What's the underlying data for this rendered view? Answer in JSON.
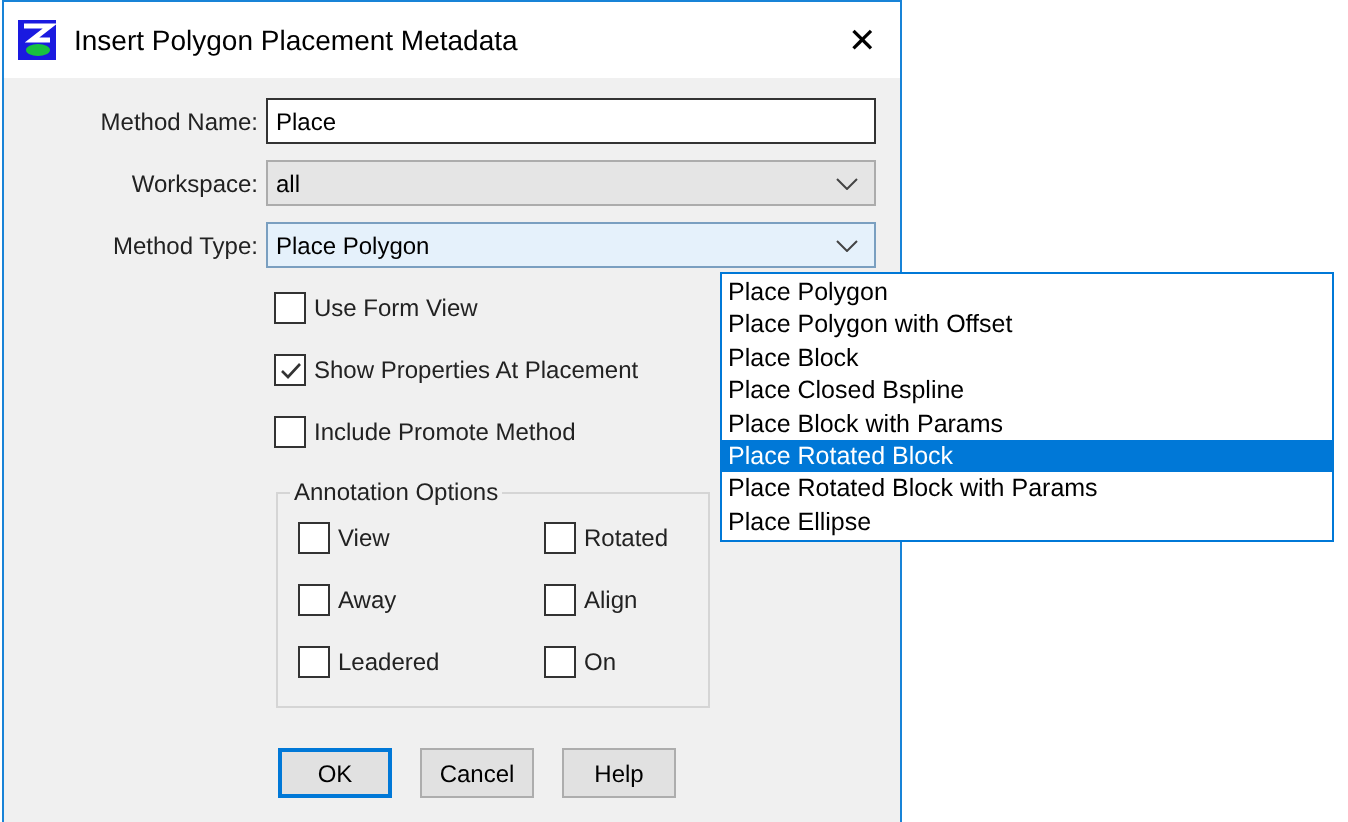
{
  "window": {
    "title": "Insert Polygon Placement Metadata",
    "close": "✕"
  },
  "fields": [
    {
      "kind": "text",
      "label": "Method Name:",
      "value": "Place"
    },
    {
      "kind": "dropdown",
      "label": "Workspace:",
      "value": "all"
    },
    {
      "kind": "dropdown",
      "label": "Method Type:",
      "value": "Place Polygon",
      "expanded": true
    }
  ],
  "checkboxes": [
    {
      "label": "Use Form View",
      "checked": false
    },
    {
      "label": "Show Properties At Placement",
      "checked": true
    },
    {
      "label": "Include Promote Method",
      "checked": false
    }
  ],
  "annotation_options": {
    "title": "Annotation Options",
    "options": [
      {
        "label": "View",
        "checked": false
      },
      {
        "label": "Rotated",
        "checked": false
      },
      {
        "label": "Away",
        "checked": false
      },
      {
        "label": "Align",
        "checked": false
      },
      {
        "label": "Leadered",
        "checked": false
      },
      {
        "label": "On",
        "checked": false
      }
    ]
  },
  "buttons": [
    {
      "label": "OK",
      "default": true
    },
    {
      "label": "Cancel",
      "default": false
    },
    {
      "label": "Help",
      "default": false
    }
  ],
  "dropdown_list": [
    {
      "label": "Place Polygon",
      "selected": false
    },
    {
      "label": "Place Polygon with Offset",
      "selected": false
    },
    {
      "label": "Place Block",
      "selected": false
    },
    {
      "label": "Place Closed Bspline",
      "selected": false
    },
    {
      "label": "Place Block with Params",
      "selected": false
    },
    {
      "label": "Place Rotated Block",
      "selected": true
    },
    {
      "label": "Place Rotated Block with Params",
      "selected": false
    },
    {
      "label": "Place Ellipse",
      "selected": false
    }
  ]
}
